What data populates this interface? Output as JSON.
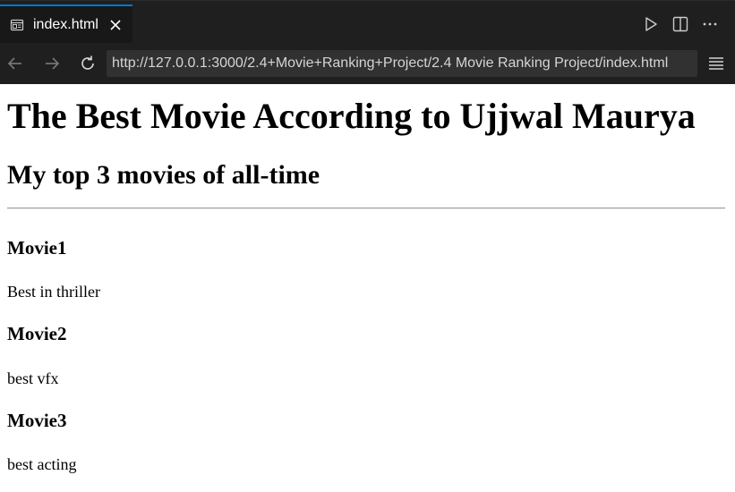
{
  "tab": {
    "label": "index.html",
    "icon": "preview-icon",
    "close_icon": "close-icon"
  },
  "toolbar": {
    "run_icon": "play-icon",
    "split_icon": "split-editor-icon",
    "more_icon": "more-icon"
  },
  "nav": {
    "back_icon": "arrow-left-icon",
    "forward_icon": "arrow-right-icon",
    "reload_icon": "reload-icon",
    "url": "http://127.0.0.1:3000/2.4+Movie+Ranking+Project/2.4 Movie Ranking Project/index.html",
    "menu_icon": "menu-icon"
  },
  "page": {
    "title": "The Best Movie According to Ujjwal Maurya",
    "subtitle": "My top 3 movies of all-time",
    "movies": [
      {
        "name": "Movie1",
        "description": "Best in thriller"
      },
      {
        "name": "Movie2",
        "description": "best vfx"
      },
      {
        "name": "Movie3",
        "description": "best acting"
      }
    ]
  },
  "colors": {
    "chrome_bg": "#1f1f1f",
    "active_tab_bg": "#181818",
    "active_tab_accent": "#0078d4",
    "url_bg": "#313131",
    "page_bg": "#ffffff"
  }
}
